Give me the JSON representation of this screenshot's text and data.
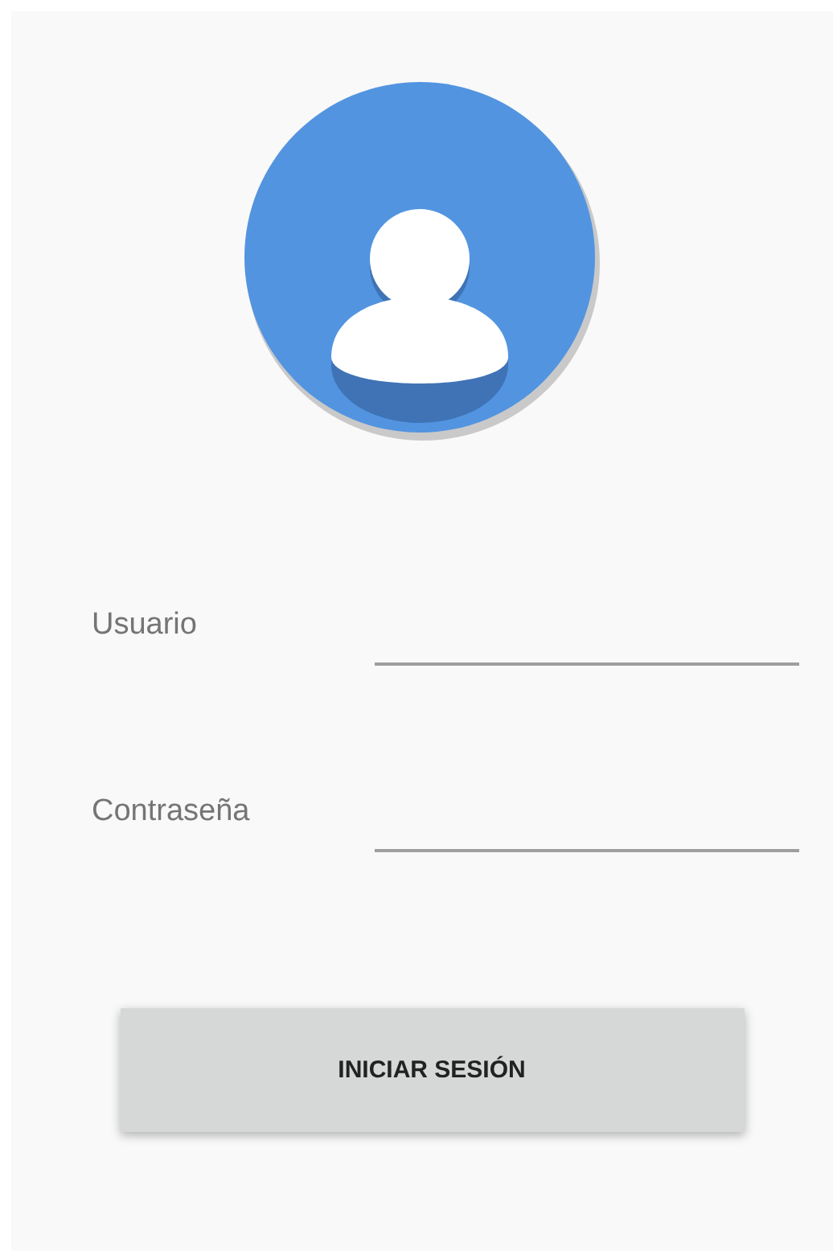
{
  "fields": [
    {
      "label": "Usuario"
    },
    {
      "label": "Contraseña"
    }
  ],
  "button": {
    "label": "INICIAR SESIÓN"
  }
}
